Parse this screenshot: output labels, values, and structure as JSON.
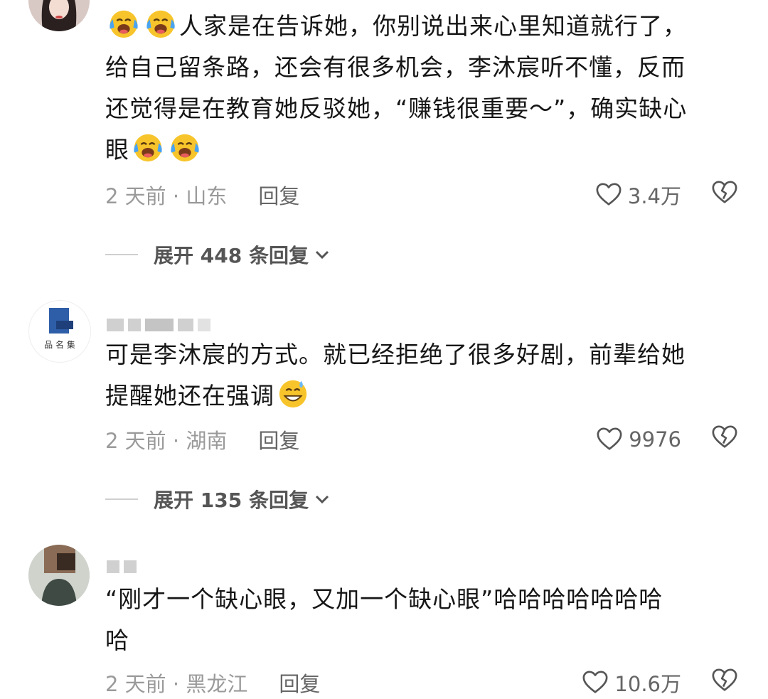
{
  "comments": [
    {
      "text_lines": [
        "人家是在告诉她，你别说出来心里知道就行了，",
        "给自己留条路，还会有很多机会，李沐宸听不懂，反而",
        "还觉得是在教育她反驳她，“赚钱很重要～”，确实缺心",
        "眼"
      ],
      "meta": {
        "time_location": "2 天前 · 山东",
        "reply": "回复",
        "likes": "3.4万"
      },
      "expand": "展开 448 条回复"
    },
    {
      "text_lines": [
        "可是李沐宸的方式。就已经拒绝了很多好剧，前辈给她",
        "提醒她还在强调"
      ],
      "meta": {
        "time_location": "2 天前 · 湖南",
        "reply": "回复",
        "likes": "9976"
      },
      "expand": "展开 135 条回复"
    },
    {
      "text_lines": [
        "“刚才一个缺心眼，又加一个缺心眼”哈哈哈哈哈哈哈",
        "哈"
      ],
      "meta": {
        "time_location": "2 天前 · 黑龙江",
        "reply": "回复",
        "likes": "10.6万"
      }
    }
  ],
  "icons": {
    "like": "heart-outline-icon",
    "dislike": "broken-heart-icon",
    "emoji_cry": "crying-laughing-face-emoji",
    "emoji_sweat": "sweat-smile-face-emoji"
  },
  "colors": {
    "meta_text": "#9a9a9a",
    "body_text": "#161616",
    "emoji_yellow": "#f7c52b",
    "emoji_tear": "#4aa3f0"
  }
}
